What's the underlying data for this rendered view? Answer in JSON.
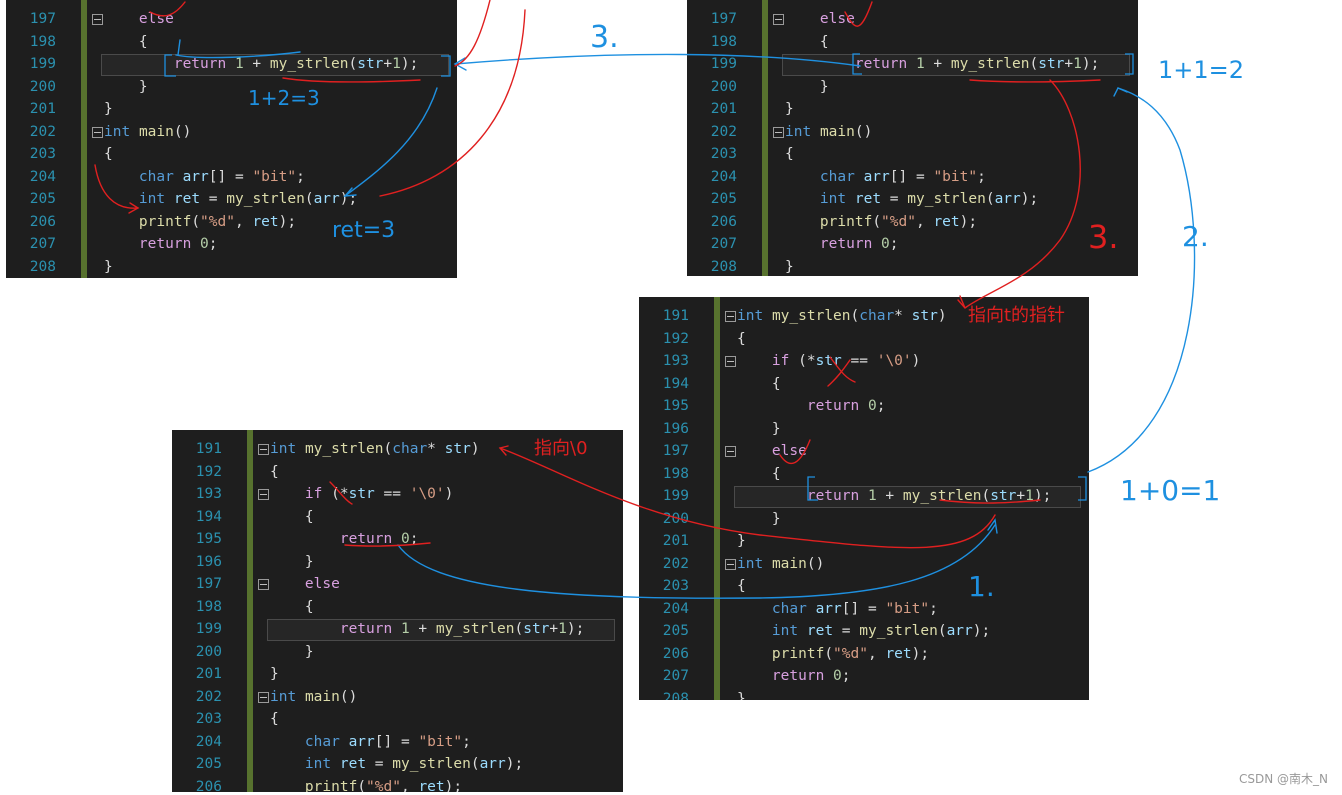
{
  "panels": {
    "top_left": {
      "lines": [
        {
          "n": "197",
          "t": "    else"
        },
        {
          "n": "198",
          "t": "    {"
        },
        {
          "n": "199",
          "t": "        return 1 + my_strlen(str+1);"
        },
        {
          "n": "200",
          "t": "    }"
        },
        {
          "n": "201",
          "t": "}"
        },
        {
          "n": "202",
          "t": "int main()"
        },
        {
          "n": "203",
          "t": "{"
        },
        {
          "n": "204",
          "t": "    char arr[] = \"bit\";"
        },
        {
          "n": "205",
          "t": "    int ret = my_strlen(arr);"
        },
        {
          "n": "206",
          "t": "    printf(\"%d\", ret);"
        },
        {
          "n": "207",
          "t": "    return 0;"
        },
        {
          "n": "208",
          "t": "}"
        }
      ]
    },
    "top_right": {
      "lines": [
        {
          "n": "197",
          "t": "    else"
        },
        {
          "n": "198",
          "t": "    {"
        },
        {
          "n": "199",
          "t": "        return 1 + my_strlen(str+1);"
        },
        {
          "n": "200",
          "t": "    }"
        },
        {
          "n": "201",
          "t": "}"
        },
        {
          "n": "202",
          "t": "int main()"
        },
        {
          "n": "203",
          "t": "{"
        },
        {
          "n": "204",
          "t": "    char arr[] = \"bit\";"
        },
        {
          "n": "205",
          "t": "    int ret = my_strlen(arr);"
        },
        {
          "n": "206",
          "t": "    printf(\"%d\", ret);"
        },
        {
          "n": "207",
          "t": "    return 0;"
        },
        {
          "n": "208",
          "t": "}"
        }
      ]
    },
    "middle_right": {
      "lines": [
        {
          "n": "191",
          "t": "int my_strlen(char* str)"
        },
        {
          "n": "192",
          "t": "{"
        },
        {
          "n": "193",
          "t": "    if (*str == '\\0')"
        },
        {
          "n": "194",
          "t": "    {"
        },
        {
          "n": "195",
          "t": "        return 0;"
        },
        {
          "n": "196",
          "t": "    }"
        },
        {
          "n": "197",
          "t": "    else"
        },
        {
          "n": "198",
          "t": "    {"
        },
        {
          "n": "199",
          "t": "        return 1 + my_strlen(str+1);"
        },
        {
          "n": "200",
          "t": "    }"
        },
        {
          "n": "201",
          "t": "}"
        },
        {
          "n": "202",
          "t": "int main()"
        },
        {
          "n": "203",
          "t": "{"
        },
        {
          "n": "204",
          "t": "    char arr[] = \"bit\";"
        },
        {
          "n": "205",
          "t": "    int ret = my_strlen(arr);"
        },
        {
          "n": "206",
          "t": "    printf(\"%d\", ret);"
        },
        {
          "n": "207",
          "t": "    return 0;"
        },
        {
          "n": "208",
          "t": "}"
        }
      ]
    },
    "bottom_left": {
      "lines": [
        {
          "n": "191",
          "t": "int my_strlen(char* str)"
        },
        {
          "n": "192",
          "t": "{"
        },
        {
          "n": "193",
          "t": "    if (*str == '\\0')"
        },
        {
          "n": "194",
          "t": "    {"
        },
        {
          "n": "195",
          "t": "        return 0;"
        },
        {
          "n": "196",
          "t": "    }"
        },
        {
          "n": "197",
          "t": "    else"
        },
        {
          "n": "198",
          "t": "    {"
        },
        {
          "n": "199",
          "t": "        return 1 + my_strlen(str+1);"
        },
        {
          "n": "200",
          "t": "    }"
        },
        {
          "n": "201",
          "t": "}"
        },
        {
          "n": "202",
          "t": "int main()"
        },
        {
          "n": "203",
          "t": "{"
        },
        {
          "n": "204",
          "t": "    char arr[] = \"bit\";"
        },
        {
          "n": "205",
          "t": "    int ret = my_strlen(arr);"
        },
        {
          "n": "206",
          "t": "    printf(\"%d\", ret);"
        }
      ]
    }
  },
  "annotations": {
    "label_3_top": "3.",
    "label_1plus2": "1+2=3",
    "label_ret3": "ret=3",
    "label_1plus1": "1+1=2",
    "label_3_mid": "3.",
    "label_2": "2.",
    "label_point_t": "指向t的指针",
    "label_point_null": "指向\\0",
    "label_1plus0": "1+0=1",
    "label_1": "1."
  },
  "watermark": "CSDN @南木_N",
  "colors": {
    "editor_bg": "#1e1e1e",
    "line_number": "#2b91af",
    "keyword": "#569cd6",
    "function": "#dcdcaa",
    "string": "#d69d85",
    "red_ink": "#e02020",
    "blue_ink": "#1e90e0"
  }
}
